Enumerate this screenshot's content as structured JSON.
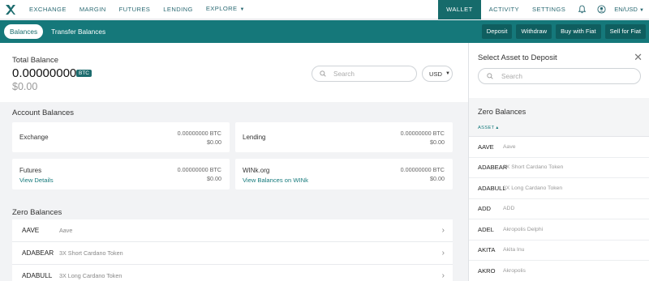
{
  "nav": {
    "links": [
      "EXCHANGE",
      "MARGIN",
      "FUTURES",
      "LENDING",
      "EXPLORE"
    ],
    "wallet": "WALLET",
    "activity": "ACTIVITY",
    "settings": "SETTINGS",
    "locale": "EN/USD"
  },
  "subbar": {
    "tab_active": "Balances",
    "tab_other": "Transfer Balances",
    "buttons": [
      "Deposit",
      "Withdraw",
      "Buy with Fiat",
      "Sell for Fiat"
    ]
  },
  "totals": {
    "label": "Total Balance",
    "amount": "0.00000000",
    "currency": "BTC",
    "usd": "$0.00",
    "search_placeholder": "Search",
    "fiat_select": "USD"
  },
  "accounts": {
    "title": "Account Balances",
    "cards": [
      {
        "name": "Exchange",
        "btc": "0.00000000 BTC",
        "usd": "$0.00",
        "link": ""
      },
      {
        "name": "Lending",
        "btc": "0.00000000 BTC",
        "usd": "$0.00",
        "link": ""
      },
      {
        "name": "Futures",
        "btc": "0.00000000 BTC",
        "usd": "$0.00",
        "link": "View Details"
      },
      {
        "name": "WINk.org",
        "btc": "0.00000000 BTC",
        "usd": "$0.00",
        "link": "View Balances on WINk"
      }
    ]
  },
  "zero": {
    "title": "Zero Balances",
    "rows": [
      {
        "sym": "AAVE",
        "name": "Aave"
      },
      {
        "sym": "ADABEAR",
        "name": "3X Short Cardano Token"
      },
      {
        "sym": "ADABULL",
        "name": "3X Long Cardano Token"
      }
    ]
  },
  "panel": {
    "title": "Select Asset to Deposit",
    "search_placeholder": "Search",
    "zero_title": "Zero Balances",
    "col_header": "ASSET ▴",
    "rows": [
      {
        "sym": "AAVE",
        "name": "Aave"
      },
      {
        "sym": "ADABEAR",
        "name": "3X Short Cardano Token"
      },
      {
        "sym": "ADABULL",
        "name": "3X Long Cardano Token"
      },
      {
        "sym": "ADD",
        "name": "ADD"
      },
      {
        "sym": "ADEL",
        "name": "Akropolis Delphi"
      },
      {
        "sym": "AKITA",
        "name": "Akita Inu"
      },
      {
        "sym": "AKRO",
        "name": "Akropolis"
      }
    ]
  },
  "colors": {
    "teal": "#15787a",
    "teal_dark": "#0f5e5f",
    "link": "#2b6a73"
  }
}
